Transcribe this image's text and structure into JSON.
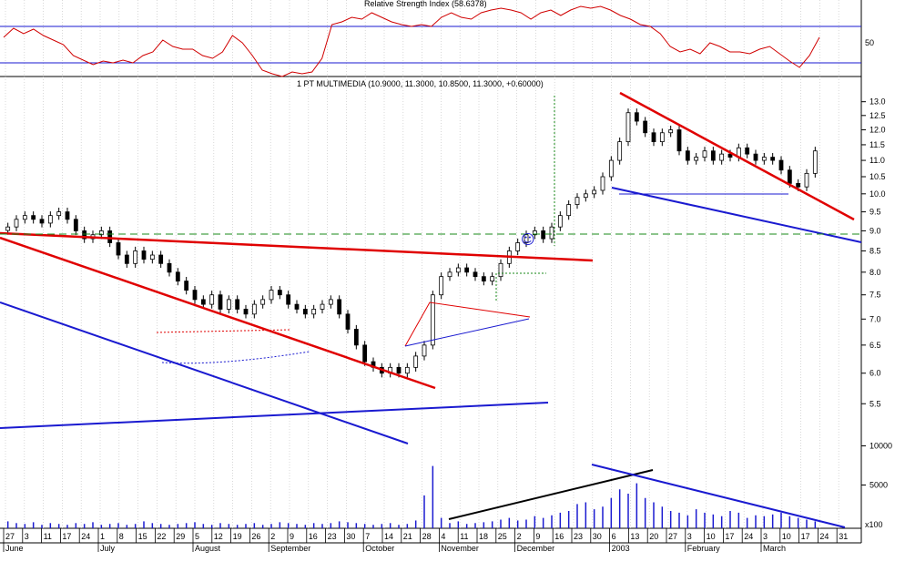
{
  "chart_data": [
    {
      "type": "line",
      "title": "Relative Strength Index (58.6378)",
      "ylabels": [
        "50"
      ],
      "levels": [
        70,
        30
      ],
      "ylim": [
        15,
        95
      ],
      "series": [
        {
          "values": [
            58,
            68,
            62,
            67,
            60,
            55,
            50,
            38,
            33,
            28,
            32,
            30,
            33,
            30,
            38,
            42,
            55,
            48,
            45,
            45,
            38,
            35,
            42,
            60,
            52,
            38,
            22,
            18,
            15,
            20,
            18,
            20,
            35,
            72,
            75,
            80,
            78,
            85,
            80,
            75,
            72,
            70,
            72,
            70,
            80,
            85,
            80,
            78,
            85,
            88,
            90,
            88,
            85,
            78,
            85,
            88,
            82,
            88,
            92,
            90,
            92,
            88,
            82,
            78,
            72,
            70,
            62,
            48,
            42,
            45,
            40,
            52,
            48,
            42,
            42,
            40,
            45,
            48,
            40,
            32,
            25,
            38,
            58
          ]
        }
      ]
    },
    {
      "type": "candlestick",
      "title": "1 PT MULTIMEDIA (10.9000, 11.3000, 10.8500, 11.3000, +0.60000)",
      "y_scale": "log",
      "ylim": [
        5.0,
        13.4
      ],
      "yticks": [
        "13.0",
        "12.5",
        "12.0",
        "11.5",
        "11.0",
        "10.5",
        "10.0",
        "9.5",
        "9.0",
        "8.5",
        "8.0",
        "7.5",
        "7.0",
        "6.5",
        "6.0",
        "5.5"
      ],
      "close": [
        9.1,
        9.3,
        9.4,
        9.3,
        9.2,
        9.4,
        9.5,
        9.3,
        9.0,
        8.8,
        8.9,
        9.0,
        8.7,
        8.4,
        8.2,
        8.5,
        8.3,
        8.4,
        8.2,
        8.0,
        7.8,
        7.6,
        7.4,
        7.3,
        7.5,
        7.2,
        7.4,
        7.2,
        7.1,
        7.3,
        7.4,
        7.6,
        7.5,
        7.3,
        7.2,
        7.1,
        7.2,
        7.3,
        7.4,
        7.1,
        6.8,
        6.5,
        6.2,
        6.1,
        6.0,
        6.1,
        6.0,
        6.1,
        6.3,
        6.5,
        7.5,
        7.9,
        8.0,
        8.1,
        8.0,
        7.9,
        7.8,
        7.9,
        8.2,
        8.5,
        8.7,
        8.9,
        9.0,
        8.8,
        9.1,
        9.4,
        9.7,
        9.9,
        10.0,
        10.1,
        10.5,
        11.0,
        11.6,
        12.6,
        12.3,
        11.9,
        11.6,
        11.9,
        12.0,
        11.3,
        11.0,
        11.1,
        11.3,
        11.0,
        11.2,
        11.1,
        11.4,
        11.2,
        11.0,
        11.1,
        11.0,
        10.7,
        10.3,
        10.2,
        10.6,
        11.3
      ],
      "series": []
    },
    {
      "type": "bar",
      "title": "",
      "yticks": [
        "10000",
        "5000"
      ],
      "unit_label": "x100",
      "values": [
        8,
        6,
        5,
        7,
        4,
        6,
        5,
        4,
        6,
        5,
        7,
        4,
        5,
        6,
        4,
        5,
        8,
        6,
        5,
        4,
        5,
        6,
        7,
        5,
        4,
        6,
        5,
        4,
        5,
        6,
        4,
        5,
        7,
        6,
        5,
        4,
        6,
        5,
        6,
        8,
        7,
        6,
        5,
        4,
        5,
        6,
        4,
        5,
        9,
        38,
        72,
        12,
        6,
        8,
        5,
        6,
        7,
        8,
        10,
        12,
        9,
        10,
        14,
        12,
        15,
        18,
        20,
        28,
        30,
        22,
        25,
        35,
        45,
        40,
        52,
        35,
        30,
        25,
        20,
        18,
        15,
        22,
        18,
        16,
        14,
        20,
        18,
        12,
        15,
        14,
        16,
        18,
        14,
        12,
        10,
        8
      ]
    }
  ],
  "axis": {
    "day_ticks": [
      "27",
      "3",
      "11",
      "17",
      "24",
      "1",
      "8",
      "15",
      "22",
      "29",
      "5",
      "12",
      "19",
      "26",
      "2",
      "9",
      "16",
      "23",
      "30",
      "7",
      "14",
      "21",
      "28",
      "4",
      "11",
      "18",
      "25",
      "2",
      "9",
      "16",
      "23",
      "30",
      "6",
      "13",
      "20",
      "27",
      "3",
      "10",
      "17",
      "24",
      "3",
      "10",
      "17",
      "24",
      "31"
    ],
    "month_labels": [
      "June",
      "July",
      "August",
      "September",
      "October",
      "November",
      "December",
      "2003",
      "February",
      "March"
    ]
  },
  "annotations": {
    "smiley": "☺"
  }
}
